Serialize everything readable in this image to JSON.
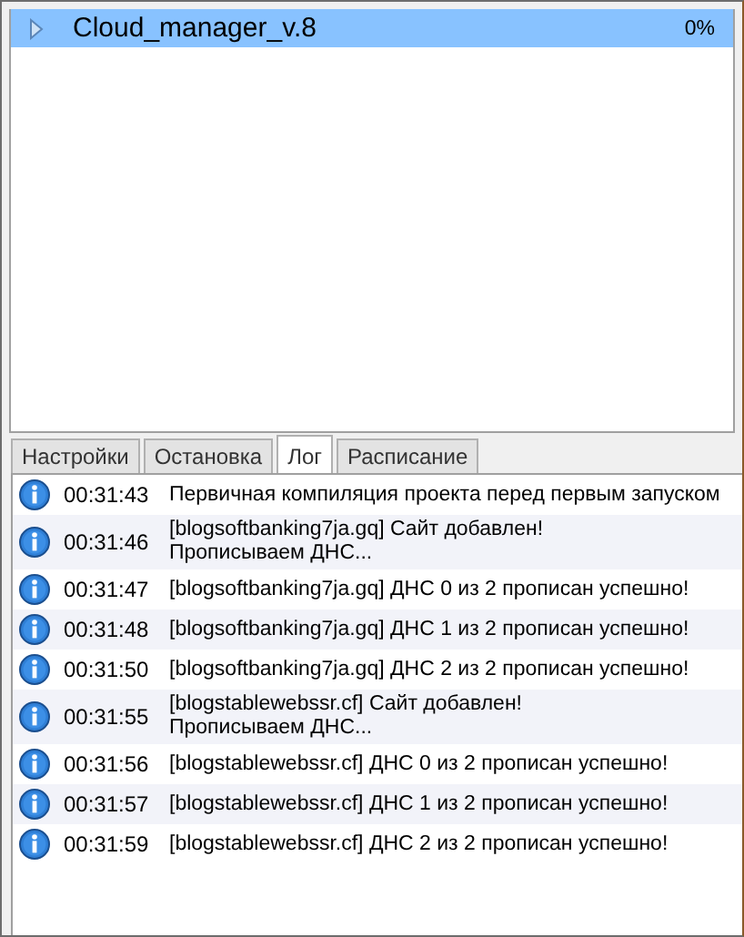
{
  "projects": [
    {
      "name": "Cloud_manager_v.8",
      "progress": "0%",
      "selected": true
    }
  ],
  "tabs": [
    {
      "label": "Настройки",
      "selected": false
    },
    {
      "label": "Остановка",
      "selected": false
    },
    {
      "label": "Лог",
      "selected": true
    },
    {
      "label": "Расписание",
      "selected": false
    }
  ],
  "log": [
    {
      "time": "00:31:43",
      "lines": [
        "Первичная компиляция проекта перед первым запуском"
      ]
    },
    {
      "time": "00:31:46",
      "lines": [
        "[blogsoftbanking7ja.gq] Сайт добавлен!",
        "Прописываем ДНС..."
      ]
    },
    {
      "time": "00:31:47",
      "lines": [
        "[blogsoftbanking7ja.gq] ДНС 0 из 2 прописан успешно!"
      ]
    },
    {
      "time": "00:31:48",
      "lines": [
        "[blogsoftbanking7ja.gq] ДНС 1 из 2 прописан успешно!"
      ]
    },
    {
      "time": "00:31:50",
      "lines": [
        "[blogsoftbanking7ja.gq] ДНС 2 из 2 прописан успешно!"
      ]
    },
    {
      "time": "00:31:55",
      "lines": [
        "[blogstablewebssr.cf] Сайт добавлен!",
        "Прописываем ДНС..."
      ]
    },
    {
      "time": "00:31:56",
      "lines": [
        "[blogstablewebssr.cf] ДНС 0 из 2 прописан успешно!"
      ]
    },
    {
      "time": "00:31:57",
      "lines": [
        "[blogstablewebssr.cf] ДНС 1 из 2 прописан успешно!"
      ]
    },
    {
      "time": "00:31:59",
      "lines": [
        "[blogstablewebssr.cf] ДНС 2 из 2 прописан успешно!"
      ]
    }
  ]
}
